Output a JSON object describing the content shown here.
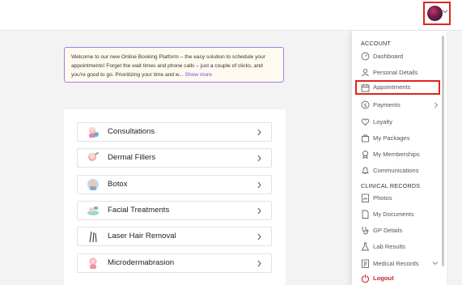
{
  "header": {
    "avatar_alt": "User avatar",
    "menu_open": true
  },
  "welcome": {
    "text": "Welcome to our new Online Booking Platform – the easy solution to schedule your appointments! Forget the wait times and phone calls – just a couple of clicks, and you're good to go. Prioritizing your time and w...",
    "show_more": "Show more"
  },
  "services": [
    {
      "label": "Consultations",
      "icon": "consultation-icon"
    },
    {
      "label": "Dermal Fillers",
      "icon": "dermal-fillers-icon"
    },
    {
      "label": "Botox",
      "icon": "botox-icon"
    },
    {
      "label": "Facial Treatments",
      "icon": "facial-treatments-icon"
    },
    {
      "label": "Laser Hair Removal",
      "icon": "laser-hair-removal-icon"
    },
    {
      "label": "Microdermabrasion",
      "icon": "microdermabrasion-icon"
    }
  ],
  "menu": {
    "account_heading": "ACCOUNT",
    "account_items": [
      {
        "label": "Dashboard",
        "icon": "dashboard-icon"
      },
      {
        "label": "Personal Details",
        "icon": "person-icon"
      },
      {
        "label": "Appointments",
        "icon": "calendar-icon"
      },
      {
        "label": "Payments",
        "icon": "dollar-icon"
      },
      {
        "label": "Loyalty",
        "icon": "heart-icon"
      },
      {
        "label": "My Packages",
        "icon": "bag-icon"
      },
      {
        "label": "My Memberships",
        "icon": "badge-icon"
      },
      {
        "label": "Communications",
        "icon": "bell-icon"
      }
    ],
    "clinical_heading": "CLINICAL RECORDS",
    "clinical_items": [
      {
        "label": "Photos",
        "icon": "photo-icon"
      },
      {
        "label": "My Documents",
        "icon": "document-icon"
      },
      {
        "label": "GP Details",
        "icon": "stethoscope-icon"
      },
      {
        "label": "Lab Results",
        "icon": "flask-icon"
      },
      {
        "label": "Medical Records",
        "icon": "medical-record-icon"
      }
    ],
    "logout": "Logout"
  },
  "colors": {
    "accent": "#7b3fe4",
    "highlight": "#e0261a",
    "logout": "#d2222a"
  }
}
